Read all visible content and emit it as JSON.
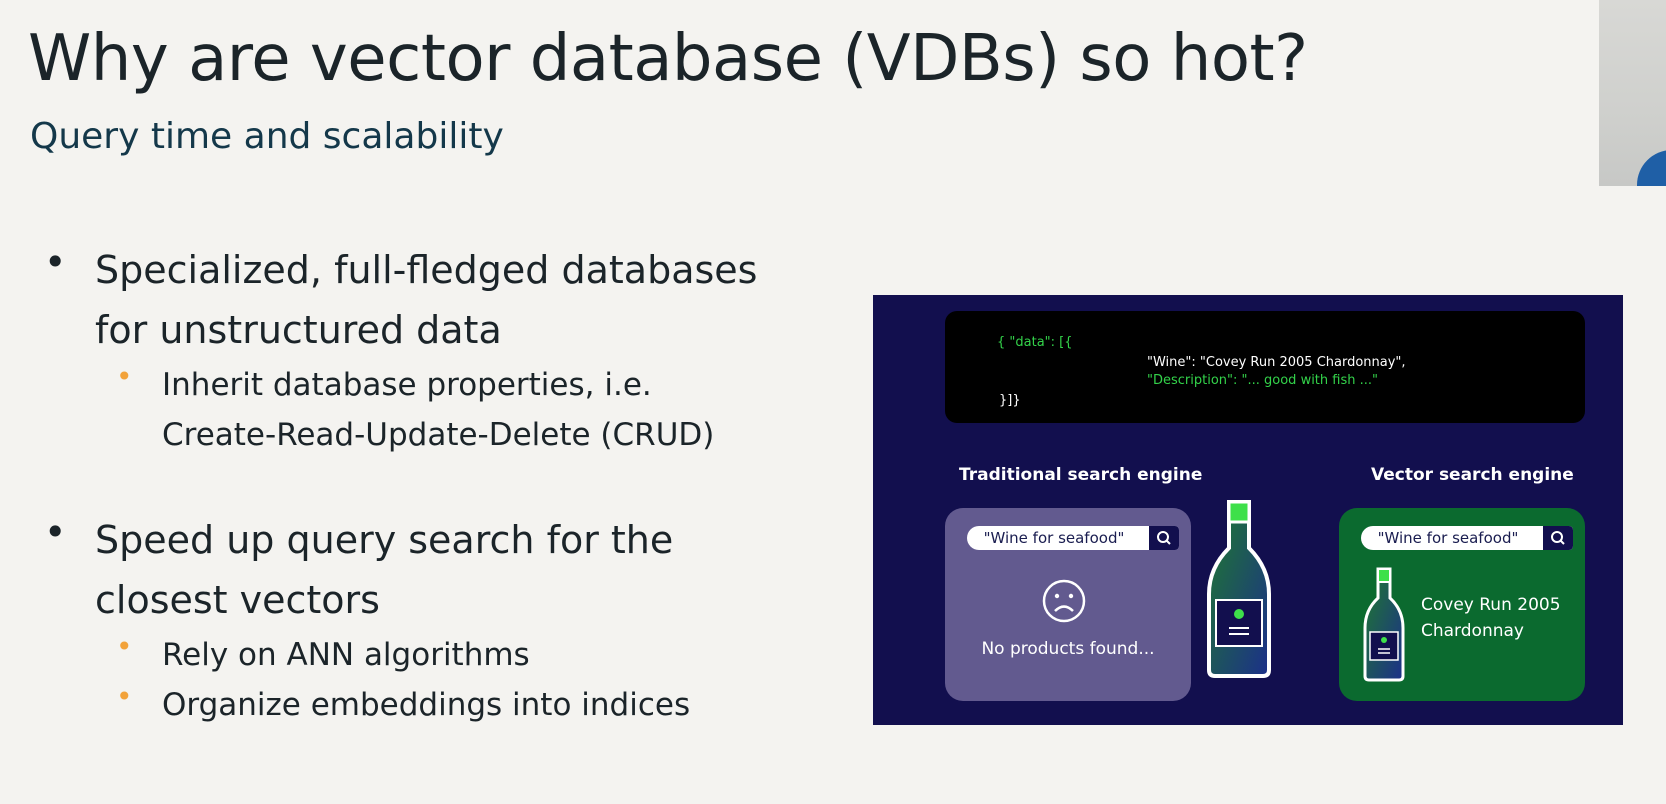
{
  "slide": {
    "title": "Why are vector database (VDBs) so hot?",
    "subtitle": "Query time and scalability",
    "bullet_marker": "•",
    "bullets": [
      {
        "lines": [
          "Specialized, full-fledged databases",
          "for unstructured data"
        ],
        "sub": [
          {
            "lines": [
              "Inherit database properties, i.e.",
              "Create-Read-Update-Delete (CRUD)"
            ]
          }
        ]
      },
      {
        "lines": [
          "Speed up query search for the",
          "closest vectors"
        ],
        "sub": [
          {
            "lines": [
              "Rely on ANN algorithms"
            ]
          },
          {
            "lines": [
              "Organize embeddings into indices"
            ]
          }
        ]
      }
    ],
    "colors": {
      "background": "#f4f3f0",
      "bullet_sub": "#f2a23a",
      "illustration_bg": "#120f4e",
      "code_green": "#33d24a",
      "panel_traditional": "#625a8f",
      "panel_vector": "#0b6a2f"
    }
  },
  "illustration": {
    "code": {
      "line1": "{ \"data\": [{",
      "line2": "\"Wine\": \"Covey Run 2005 Chardonnay\",",
      "line3": "\"Description\": \"...  good with fish ...\"",
      "line4": "}]}"
    },
    "traditional": {
      "label": "Traditional search engine",
      "query": "\"Wine for seafood\"",
      "icon": "search-icon",
      "result_icon": "sad-face-icon",
      "result": "No products found..."
    },
    "vector": {
      "label": "Vector search engine",
      "query": "\"Wine for seafood\"",
      "icon": "search-icon",
      "result_icon": "wine-bottle-icon",
      "result_line1": "Covey Run 2005",
      "result_line2": "Chardonnay"
    }
  }
}
